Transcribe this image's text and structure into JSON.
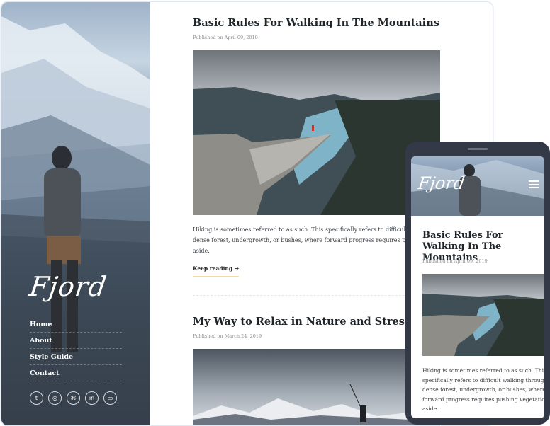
{
  "desktop": {
    "sidebar": {
      "logo": "Fjord",
      "nav": [
        "Home",
        "About",
        "Style Guide",
        "Contact"
      ],
      "socials": [
        {
          "icon": "twitter-icon",
          "glyph": "t"
        },
        {
          "icon": "instagram-icon",
          "glyph": "◎"
        },
        {
          "icon": "github-icon",
          "glyph": "⌘"
        },
        {
          "icon": "linkedin-icon",
          "glyph": "in"
        },
        {
          "icon": "vimeo-icon",
          "glyph": "▭"
        }
      ]
    },
    "posts": [
      {
        "title": "Basic Rules For Walking In The Mountains",
        "date": "Published on April 09, 2019",
        "excerpt_lines": [
          "Hiking is sometimes referred to as such. This specifically refers to difficult walking",
          "dense forest, undergrowth, or bushes, where forward progress requires pushing ve",
          "aside."
        ],
        "read_more": "Keep reading →"
      },
      {
        "title": "My Way to Relax in Nature and Stress Less",
        "date": "Published on March 24, 2019"
      }
    ]
  },
  "mobile": {
    "logo": "Fjord",
    "title": "Basic Rules For Walking In The Mountains",
    "date": "Published on April 09, 2019",
    "excerpt_lines": [
      "Hiking is sometimes referred to as such. This",
      "specifically refers to difficult walking through",
      "dense forest, undergrowth, or bushes, where",
      "forward progress requires pushing vegetation",
      "aside."
    ]
  },
  "colors": {
    "accent_underline": "#f0d7a8",
    "phone_frame": "#333947",
    "title_text": "#1e2428"
  }
}
